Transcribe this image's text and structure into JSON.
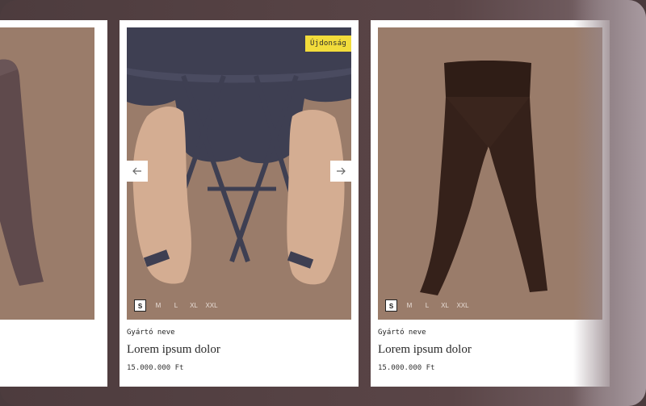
{
  "products": [
    {
      "image": "leggings-grey-partial",
      "sizes": []
    },
    {
      "image": "strappy-top-back-view",
      "badge": "Újdonság",
      "sizes": [
        "S",
        "M",
        "L",
        "XL",
        "XXL"
      ],
      "selected_size": "S",
      "brand": "Gyártó neve",
      "name": "Lorem ipsum dolor",
      "price": "15.000.000 Ft",
      "prev_icon": "arrow-left-icon",
      "next_icon": "arrow-right-icon"
    },
    {
      "image": "leggings-brown",
      "sizes": [
        "S",
        "M",
        "L",
        "XL",
        "XXL"
      ],
      "selected_size": "S",
      "brand": "Gyártó neve",
      "name": "Lorem ipsum dolor",
      "price": "15.000.000 Ft"
    }
  ],
  "colors": {
    "background": "#4d3c3e",
    "card": "#ffffff",
    "media": "#9a7c6a",
    "badge": "#f2dc3b"
  }
}
